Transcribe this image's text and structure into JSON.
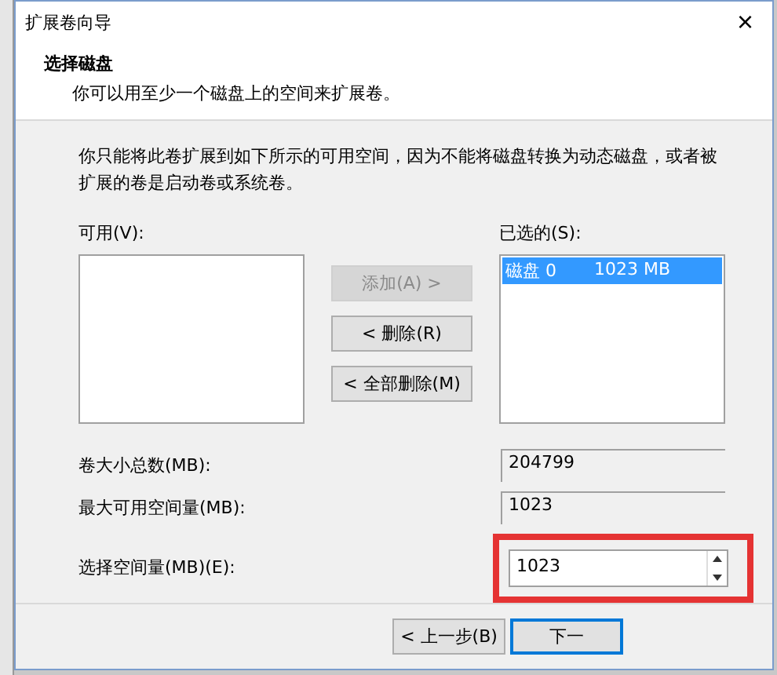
{
  "window": {
    "title": "扩展卷向导",
    "close": "×"
  },
  "header": {
    "title": "选择磁盘",
    "subtitle": "你可以用至少一个磁盘上的空间来扩展卷。"
  },
  "notice": "你只能将此卷扩展到如下所示的可用空间，因为不能将磁盘转换为动态磁盘，或者被扩展的卷是启动卷或系统卷。",
  "available": {
    "label": "可用(V):"
  },
  "transfer_buttons": [
    {
      "label": "添加(A) >",
      "disabled": true
    },
    {
      "label": "< 删除(R)",
      "disabled": false
    },
    {
      "label": "< 全部删除(M)",
      "disabled": false
    }
  ],
  "selected_list": {
    "label": "已选的(S):",
    "items": [
      {
        "disk": "磁盘 0",
        "size": "1023 MB",
        "selected": true
      }
    ]
  },
  "fields": [
    {
      "label": "卷大小总数(MB):",
      "value": "204799",
      "kind": "readonly"
    },
    {
      "label": "最大可用空间量(MB):",
      "value": "1023",
      "kind": "readonly"
    },
    {
      "label": "选择空间量(MB)(E):",
      "value": "1023",
      "kind": "spinner",
      "highlighted": true
    }
  ],
  "footer_buttons": [
    {
      "label": "< 上一步(B)",
      "default": false
    },
    {
      "label": "下一",
      "default": true
    }
  ]
}
